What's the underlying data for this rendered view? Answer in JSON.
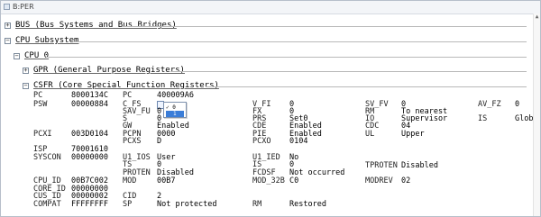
{
  "window": {
    "title": "B:PER"
  },
  "groups": {
    "bus": "BUS (Bus Systems and Bus Bridges)",
    "cpu_subsystem": "CPU Subsystem",
    "cpu0": "CPU 0",
    "gpr": "GPR (General Purpose Registers)",
    "csfr": "CSFR (Core Special Function Registers)"
  },
  "regs": {
    "pc": {
      "n": "PC",
      "v": "8000134C"
    },
    "psw": {
      "n": "PSW",
      "v": "00000884"
    },
    "pcxi": {
      "n": "PCXI",
      "v": "003D0104"
    },
    "isp": {
      "n": "ISP",
      "v": "70001610"
    },
    "syscon": {
      "n": "SYSCON",
      "v": "00000000"
    },
    "cpu_id": {
      "n": "CPU_ID",
      "v": "00B7C002"
    },
    "core_id": {
      "n": "CORE_ID",
      "v": "00000000"
    },
    "cus_id": {
      "n": "CUS_ID",
      "v": "00000002"
    },
    "compat": {
      "n": "COMPAT",
      "v": "FFFFFFFF"
    }
  },
  "c2": {
    "pc": {
      "n": "PC",
      "v": "400009A6"
    },
    "c_fs": {
      "n": "C_FS",
      "v": "0"
    },
    "sav_fu": {
      "n": "SAV_FU",
      "v": "0"
    },
    "s": {
      "n": "S",
      "v": "0"
    },
    "gw": {
      "n": "GW",
      "v": "Enabled"
    },
    "pcpn": {
      "n": "PCPN",
      "v": "0000"
    },
    "pcxs": {
      "n": "PCXS",
      "v": "D"
    },
    "u1_ios": {
      "n": "U1_IOS",
      "v": "User"
    },
    "ts": {
      "n": "TS",
      "v": "0"
    },
    "proten": {
      "n": "PROTEN",
      "v": "Disabled"
    },
    "mod": {
      "n": "MOD",
      "v": "00B7"
    },
    "cid": {
      "n": "CID",
      "v": "2"
    },
    "sp": {
      "n": "SP",
      "v": "Not protected"
    }
  },
  "c3": {
    "v_fi": {
      "n": "V_FI",
      "v": "0"
    },
    "fx": {
      "n": "FX",
      "v": "0"
    },
    "prs": {
      "n": "PRS",
      "v": "Set0"
    },
    "cde": {
      "n": "CDE",
      "v": "Enabled"
    },
    "pie": {
      "n": "PIE",
      "v": "Enabled"
    },
    "pcxo": {
      "n": "PCXO",
      "v": "0104"
    },
    "u1_ied": {
      "n": "U1_IED",
      "v": "No"
    },
    "is": {
      "n": "IS",
      "v": "0"
    },
    "fcdsf": {
      "n": "FCDSF",
      "v": "Not occurred"
    },
    "mod_32b": {
      "n": "MOD_32B",
      "v": "C0"
    },
    "rm": {
      "n": "RM",
      "v": "Restored"
    }
  },
  "c4": {
    "sv_fv": {
      "n": "SV_FV",
      "v": "0"
    },
    "rm": {
      "n": "RM",
      "v": "To nearest"
    },
    "io": {
      "n": "IO",
      "v": "Supervisor"
    },
    "cdc": {
      "n": "CDC",
      "v": "04"
    },
    "ul": {
      "n": "UL",
      "v": "Upper"
    },
    "tproten": {
      "n": "TPROTEN",
      "v": "Disabled"
    },
    "modrev": {
      "n": "MODREV",
      "v": "02"
    }
  },
  "c5": {
    "av_fz": {
      "n": "AV_FZ",
      "v": "0"
    },
    "is": {
      "n": "IS",
      "v": "Glob"
    }
  },
  "popup": {
    "opt0": "0",
    "opt1": "1"
  }
}
